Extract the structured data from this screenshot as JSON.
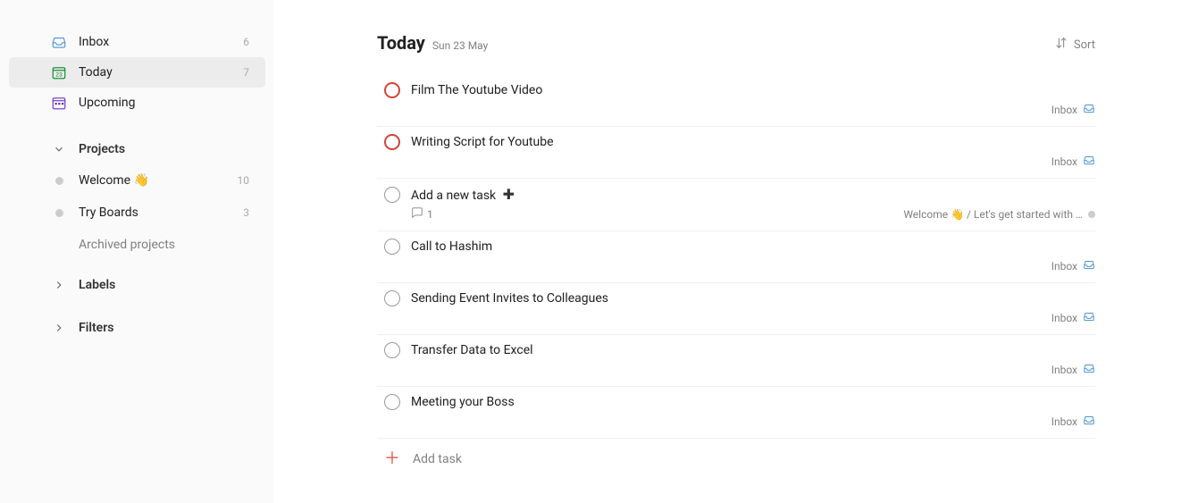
{
  "sidebar": {
    "nav": [
      {
        "id": "inbox",
        "label": "Inbox",
        "count": "6",
        "selected": false
      },
      {
        "id": "today",
        "label": "Today",
        "count": "7",
        "selected": true
      },
      {
        "id": "upcoming",
        "label": "Upcoming",
        "count": "",
        "selected": false
      }
    ],
    "projects_header": "Projects",
    "projects": [
      {
        "label": "Welcome",
        "emoji": "👋",
        "count": "10"
      },
      {
        "label": "Try Boards",
        "emoji": "",
        "count": "3"
      }
    ],
    "archived_label": "Archived projects",
    "labels_header": "Labels",
    "filters_header": "Filters"
  },
  "header": {
    "title": "Today",
    "date": "Sun 23 May",
    "sort_label": "Sort"
  },
  "tasks": [
    {
      "title": "Film The Youtube Video",
      "priority": "p1",
      "project": "Inbox",
      "project_kind": "inbox"
    },
    {
      "title": "Writing Script for Youtube",
      "priority": "p1",
      "project": "Inbox",
      "project_kind": "inbox"
    },
    {
      "title": "Add a new task",
      "priority": "",
      "has_plus": true,
      "comments": "1",
      "project": "Welcome 👋 / Let's get started with …",
      "project_kind": "gray"
    },
    {
      "title": "Call to Hashim",
      "priority": "",
      "project": "Inbox",
      "project_kind": "inbox"
    },
    {
      "title": "Sending Event Invites to Colleagues",
      "priority": "",
      "project": "Inbox",
      "project_kind": "inbox"
    },
    {
      "title": "Transfer Data to Excel",
      "priority": "",
      "project": "Inbox",
      "project_kind": "inbox"
    },
    {
      "title": "Meeting your Boss",
      "priority": "",
      "project": "Inbox",
      "project_kind": "inbox"
    }
  ],
  "add_task_label": "Add task"
}
